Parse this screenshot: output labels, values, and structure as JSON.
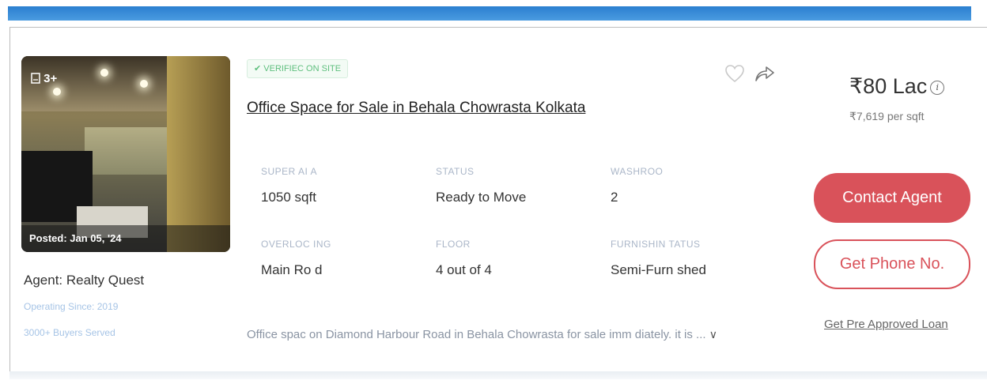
{
  "listing": {
    "photo_count": "3+",
    "posted": "Posted: Jan 05, '24",
    "verified_badge": "✔ VERIFIEC ON SITE",
    "title": "Office Space for Sale in Behala Chowrasta Kolkata",
    "description": "Office spac  on Diamond Harbour Road in Behala Chowrasta for sale imm  diately. it is ...",
    "details": [
      {
        "label": "SUPER AI  A",
        "value": "1050 sqft"
      },
      {
        "label": "STATUS",
        "value": "Ready to Move"
      },
      {
        "label": "WASHROO",
        "value": "2"
      },
      {
        "label": "OVERLOC  ING",
        "value": "Main Ro  d"
      },
      {
        "label": "FLOOR",
        "value": "4 out of 4"
      },
      {
        "label": "FURNISHIN   TATUS",
        "value": "Semi-Furn  shed"
      }
    ]
  },
  "agent": {
    "name": "Agent: Realty Quest",
    "operating_since": "Operating Since: 2019",
    "buyers_served": "3000+ Buyers Served"
  },
  "pricing": {
    "price": "₹80 Lac",
    "per_sqft": "₹7,619 per sqft",
    "contact_button": "Contact Agent",
    "phone_button": "Get Phone No.",
    "loan_link": "Get Pre Approved Loan"
  },
  "colors": {
    "accent": "#d9525a",
    "verified_green": "#5fbf7e",
    "top_bar": "#2b7fd0"
  },
  "icons": {
    "gallery": "image-icon",
    "favorite": "heart-icon",
    "share": "share-icon",
    "info": "info-icon",
    "expand": "chevron-down-icon"
  }
}
